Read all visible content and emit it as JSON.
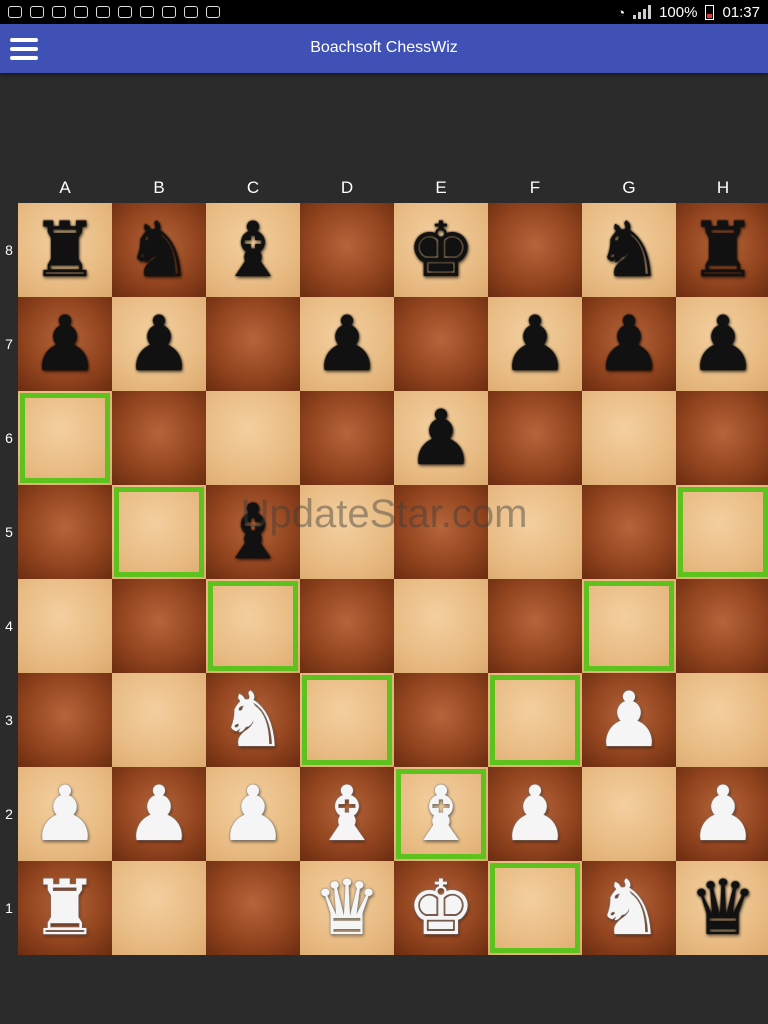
{
  "status_bar": {
    "battery_text": "100%",
    "time": "01:37"
  },
  "app_bar": {
    "title": "Boachsoft ChessWiz",
    "menu_icon": "hamburger-menu-icon"
  },
  "board": {
    "columns": [
      "A",
      "B",
      "C",
      "D",
      "E",
      "F",
      "G",
      "H"
    ],
    "rows": [
      "8",
      "7",
      "6",
      "5",
      "4",
      "3",
      "2",
      "1"
    ],
    "pieces": {
      "A8": "b-rook",
      "B8": "b-knight",
      "C8": "b-bishop",
      "E8": "b-king",
      "G8": "b-knight",
      "H8": "b-rook",
      "A7": "b-pawn",
      "B7": "b-pawn",
      "D7": "b-pawn",
      "F7": "b-pawn",
      "G7": "b-pawn",
      "H7": "b-pawn",
      "E6": "b-pawn",
      "C5": "b-bishop",
      "C3": "w-knight",
      "G3": "w-pawn",
      "A2": "w-pawn",
      "B2": "w-pawn",
      "C2": "w-pawn",
      "D2": "w-bishop",
      "E2": "w-bishop",
      "F2": "w-pawn",
      "H2": "w-pawn",
      "A1": "w-rook",
      "D1": "w-queen",
      "E1": "w-king",
      "G1": "w-knight",
      "H1": "b-queen"
    },
    "highlighted_squares": [
      "A6",
      "B5",
      "H5",
      "C4",
      "G4",
      "D3",
      "F3",
      "E2",
      "F1"
    ],
    "colors": {
      "highlight": "#5dc21e",
      "light_square": "#e8bb83",
      "dark_square": "#93451f",
      "app_bar": "#3f51b5"
    }
  },
  "watermark": "UpdateStar.com"
}
